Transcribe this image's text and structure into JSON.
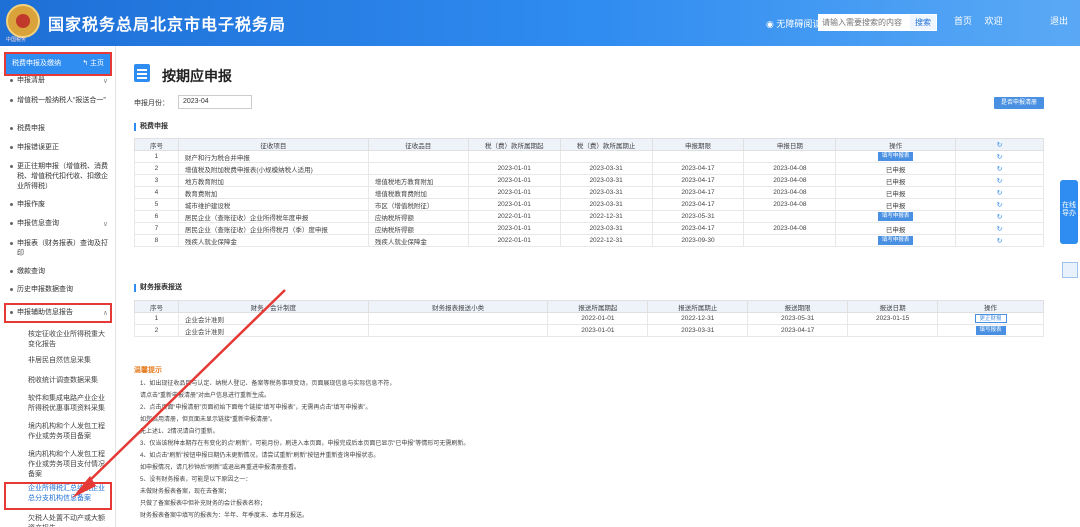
{
  "header": {
    "title": "国家税务总局北京市电子税务局",
    "brand_sub": "中国税务",
    "barrier_free": "无障碍阅读",
    "search_placeholder": "请输入需要搜索的内容",
    "search_label": "搜索",
    "home_link": "首页",
    "user_prefix": "欢迎",
    "logout": "退出"
  },
  "sidebar": {
    "head_label": "税费申报及缴纳",
    "home_label": "主页",
    "items": [
      {
        "label": "申报清册",
        "arrow": "∨"
      },
      {
        "label": "增值税一般纳税人“报送合一”"
      },
      {
        "label": "税费申报"
      },
      {
        "label": "申报错误更正"
      },
      {
        "label": "更正往期申报（增值税、消费税、增值税代扣代收、扣缴企业所得税）"
      },
      {
        "label": "申报作废"
      },
      {
        "label": "申报信息查询",
        "arrow": "∨"
      },
      {
        "label": "申报表（财务报表）查询及打印",
        "arrow": "∨"
      },
      {
        "label": "缴款查询"
      },
      {
        "label": "历史申报数据查询"
      },
      {
        "label": "申报辅助信息报告",
        "arrow": "∧"
      }
    ],
    "sub_items": [
      {
        "label": "核定征收企业所得税重大变化报告"
      },
      {
        "label": "非居民自然信息采集"
      },
      {
        "label": "税收统计调查数据采集"
      },
      {
        "label": "软件和集成电路产业企业所得税优惠事项资料采集"
      },
      {
        "label": "境内机构和个人发包工程作业或劳务项目备案"
      },
      {
        "label": "境内机构和个人发包工程作业或劳务项目支付情况备案"
      },
      {
        "label": "企业所得税汇总纳税企业总分支机构信息备案"
      },
      {
        "label": "欠税人处置不动产或大额资产报告"
      }
    ]
  },
  "main": {
    "title": "按期应申报",
    "month_label": "申报月份：",
    "month_value": "2023-04",
    "clear_button": "是否申报清册",
    "tax_section": "税费申报",
    "tax_headers": [
      "序号",
      "征收项目",
      "征收品目",
      "税（费）款所属期起",
      "税（费）款所属期止",
      "申报期限",
      "申报日期",
      "操作",
      "↻"
    ],
    "tax_rows": [
      {
        "no": "1",
        "item": "财产和行为税合并申报",
        "sub": "",
        "start": "",
        "end": "",
        "deadline": "",
        "date": "",
        "op": "填写申报表",
        "op_type": "button"
      },
      {
        "no": "2",
        "item": "增值税及附加税费申报表(小规模纳税人适用)",
        "sub": "",
        "start": "2023-01-01",
        "end": "2023-03-31",
        "deadline": "2023-04-17",
        "date": "2023-04-08",
        "op": "已申报",
        "op_type": "text"
      },
      {
        "no": "3",
        "item": "地方教育附加",
        "sub": "增值税地方教育附加",
        "start": "2023-01-01",
        "end": "2023-03-31",
        "deadline": "2023-04-17",
        "date": "2023-04-08",
        "op": "已申报",
        "op_type": "text"
      },
      {
        "no": "4",
        "item": "教育费附加",
        "sub": "增值税教育费附加",
        "start": "2023-01-01",
        "end": "2023-03-31",
        "deadline": "2023-04-17",
        "date": "2023-04-08",
        "op": "已申报",
        "op_type": "text"
      },
      {
        "no": "5",
        "item": "城市维护建设税",
        "sub": "市区（增值税附征）",
        "start": "2023-01-01",
        "end": "2023-03-31",
        "deadline": "2023-04-17",
        "date": "2023-04-08",
        "op": "已申报",
        "op_type": "text"
      },
      {
        "no": "6",
        "item": "居民企业（查账征收）企业所得税年度申报",
        "sub": "应纳税所得额",
        "start": "2022-01-01",
        "end": "2022-12-31",
        "deadline": "2023-05-31",
        "date": "",
        "op": "填写申报表",
        "op_type": "button"
      },
      {
        "no": "7",
        "item": "居民企业（查账征收）企业所得税月（季）度申报",
        "sub": "应纳税所得额",
        "start": "2023-01-01",
        "end": "2023-03-31",
        "deadline": "2023-04-17",
        "date": "2023-04-08",
        "op": "已申报",
        "op_type": "text"
      },
      {
        "no": "8",
        "item": "残疾人就业保障金",
        "sub": "残疾人就业保障金",
        "start": "2022-01-01",
        "end": "2022-12-31",
        "deadline": "2023-09-30",
        "date": "",
        "op": "填写申报表",
        "op_type": "button"
      }
    ],
    "fin_section": "财务报表报送",
    "fin_headers": [
      "序号",
      "财务、会计制度",
      "财务报表报送小类",
      "报送所属期起",
      "报送所属期止",
      "报送期限",
      "报送日期",
      "操作"
    ],
    "fin_rows": [
      {
        "no": "1",
        "system": "企业会计准则",
        "sub": "",
        "start": "2022-01-01",
        "end": "2022-12-31",
        "deadline": "2023-05-31",
        "date": "2023-01-15",
        "op": "更正财报",
        "op_type": "outline"
      },
      {
        "no": "2",
        "system": "企业会计准则",
        "sub": "",
        "start": "2023-01-01",
        "end": "2023-03-31",
        "deadline": "2023-04-17",
        "date": "",
        "op": "填写报表",
        "op_type": "button"
      }
    ],
    "tips_title": "温馨提示",
    "tips": [
      "1、如出现征收品目与认定、纳税人登记、备案等税务事项变动，页面展现信息与实际信息不符，",
      "请点击“重新申报清册”对由户信息进行重新生成。",
      "2、点击页面“申报清册”页面初始下面每个链接“填写申报表”，无需再点击“填写申报表”。",
      "如您启用清册，但页面未显示链接“重新申报清册”。",
      "无上述1、2情况请自行重新。",
      "3、仅当该税种本期存在有变化的点“刷新”，可能月份，刷进入本页面，申报完成后本页面已显示“已申报”等情形可无需刷新。",
      "4、如点击“刷新”按钮申报日期仍未更新情况，请尝试重新“刷新”按钮并重新查询申报状态。",
      "如申报情况，请几秒钟后“刷新”或退出再重进申报清册查看。",
      "5、没有财务报表，可能是以下原因之一：",
      "未做财务报表备案，现在去备案；",
      "只做了备案报表中但补充财务的会计报表名称；",
      "财务报表备案中填写的报表为：半年、年季度末、本年月报送。"
    ]
  },
  "side_float": {
    "label": "在线导办"
  }
}
